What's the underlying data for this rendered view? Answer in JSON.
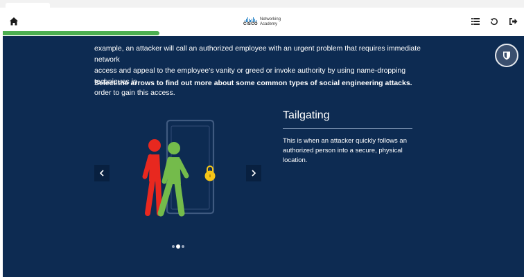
{
  "header": {
    "logo_line1": "Networking",
    "logo_line2": "Academy",
    "logo_brand": "CISCO",
    "icons": [
      "home-icon",
      "menu-list-icon",
      "reset-icon",
      "exit-icon"
    ],
    "progress_percent": 30
  },
  "content": {
    "intro_lines": [
      "example, an attacker will call an authorized employee with an urgent problem that requires immediate network",
      "access and appeal to the employee's vanity or greed or invoke authority by using name-dropping techniques in",
      "order to gain this access."
    ],
    "instruction": "Select the arrows to find out more about some common types of social engineering attacks.",
    "slide": {
      "title": "Tailgating",
      "body": "This is when an attacker quickly follows an authorized person into a secure, physical location.",
      "current_index": 1,
      "total": 3
    }
  },
  "colors": {
    "background": "#0d2b52",
    "progress": "#4caf50",
    "attacker": "#e8281f",
    "employee": "#74bb4b",
    "lock": "#f5c518"
  }
}
